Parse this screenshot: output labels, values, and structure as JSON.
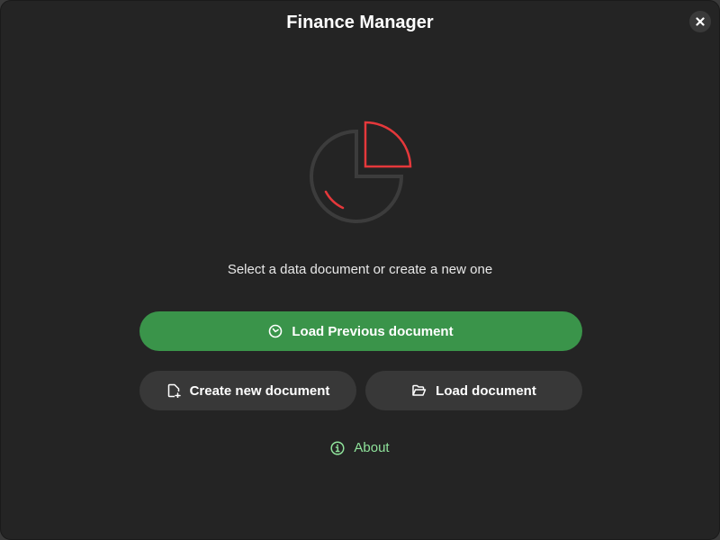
{
  "window": {
    "title": "Finance Manager",
    "close_icon": "close-icon"
  },
  "logo": {
    "icon": "pie-chart-icon",
    "accent_color": "#e5383b",
    "base_color": "#3c3c3c"
  },
  "subtitle": "Select a data document or create a new one",
  "buttons": {
    "load_previous": {
      "label": "Load Previous document",
      "icon": "clock-icon",
      "color": "#3a944a"
    },
    "create_new": {
      "label": "Create new document",
      "icon": "new-document-icon"
    },
    "load": {
      "label": "Load document",
      "icon": "folder-open-icon"
    }
  },
  "about": {
    "label": "About",
    "icon": "info-icon",
    "color": "#8fe39b"
  }
}
